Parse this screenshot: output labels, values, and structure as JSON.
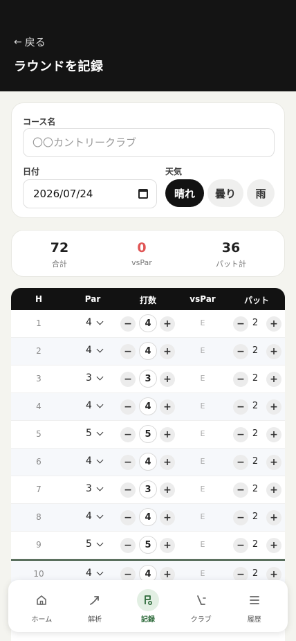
{
  "header": {
    "back_label": "戻る",
    "title": "ラウンドを記録"
  },
  "course": {
    "label": "コース名",
    "placeholder": "〇〇カントリークラブ"
  },
  "date": {
    "label": "日付",
    "value": "2026/07/24"
  },
  "weather": {
    "label": "天気",
    "options": [
      "晴れ",
      "曇り",
      "雨"
    ],
    "selected": "晴れ"
  },
  "summary": {
    "total_value": "72",
    "total_label": "合計",
    "vspar_value": "0",
    "vspar_label": "vsPar",
    "putts_value": "36",
    "putts_label": "パット計"
  },
  "table": {
    "headers": [
      "H",
      "Par",
      "打数",
      "vsPar",
      "パット"
    ],
    "rows": [
      {
        "hole": "1",
        "par": "4",
        "score": "4",
        "vs": "E",
        "putts": "2"
      },
      {
        "hole": "2",
        "par": "4",
        "score": "4",
        "vs": "E",
        "putts": "2"
      },
      {
        "hole": "3",
        "par": "3",
        "score": "3",
        "vs": "E",
        "putts": "2"
      },
      {
        "hole": "4",
        "par": "4",
        "score": "4",
        "vs": "E",
        "putts": "2"
      },
      {
        "hole": "5",
        "par": "5",
        "score": "5",
        "vs": "E",
        "putts": "2"
      },
      {
        "hole": "6",
        "par": "4",
        "score": "4",
        "vs": "E",
        "putts": "2"
      },
      {
        "hole": "7",
        "par": "3",
        "score": "3",
        "vs": "E",
        "putts": "2"
      },
      {
        "hole": "8",
        "par": "4",
        "score": "4",
        "vs": "E",
        "putts": "2"
      },
      {
        "hole": "9",
        "par": "5",
        "score": "5",
        "vs": "E",
        "putts": "2"
      },
      {
        "hole": "10",
        "par": "4",
        "score": "4",
        "vs": "E",
        "putts": "2"
      }
    ]
  },
  "nav": {
    "items": [
      {
        "label": "ホーム",
        "icon": "home-icon"
      },
      {
        "label": "解析",
        "icon": "trend-arrow-icon"
      },
      {
        "label": "記録",
        "icon": "flag-icon",
        "active": true
      },
      {
        "label": "クラブ",
        "icon": "club-icon"
      },
      {
        "label": "履歴",
        "icon": "list-icon"
      }
    ]
  },
  "colors": {
    "header_bg": "#141414",
    "accent_green": "#2d6a3a",
    "vspar_red": "#e05555"
  }
}
